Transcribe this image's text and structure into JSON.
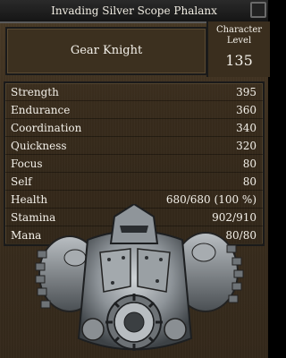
{
  "window": {
    "title": "Invading Silver Scope Phalanx"
  },
  "creature": {
    "name": "Gear Knight"
  },
  "level": {
    "label": "Character Level",
    "value": "135"
  },
  "stats": [
    {
      "label": "Strength",
      "value": "395"
    },
    {
      "label": "Endurance",
      "value": "360"
    },
    {
      "label": "Coordination",
      "value": "340"
    },
    {
      "label": "Quickness",
      "value": "320"
    },
    {
      "label": "Focus",
      "value": "80"
    },
    {
      "label": "Self",
      "value": "80"
    },
    {
      "label": "Health",
      "value": "680/680 (100 %)"
    },
    {
      "label": "Stamina",
      "value": "902/910"
    },
    {
      "label": "Mana",
      "value": "80/80"
    }
  ],
  "colors": {
    "panel_bg": "#3c2f1f",
    "text": "#f4f1ea",
    "title_bar": "#1a1a1a"
  },
  "icons": {
    "portrait": "gear-knight-portrait"
  }
}
